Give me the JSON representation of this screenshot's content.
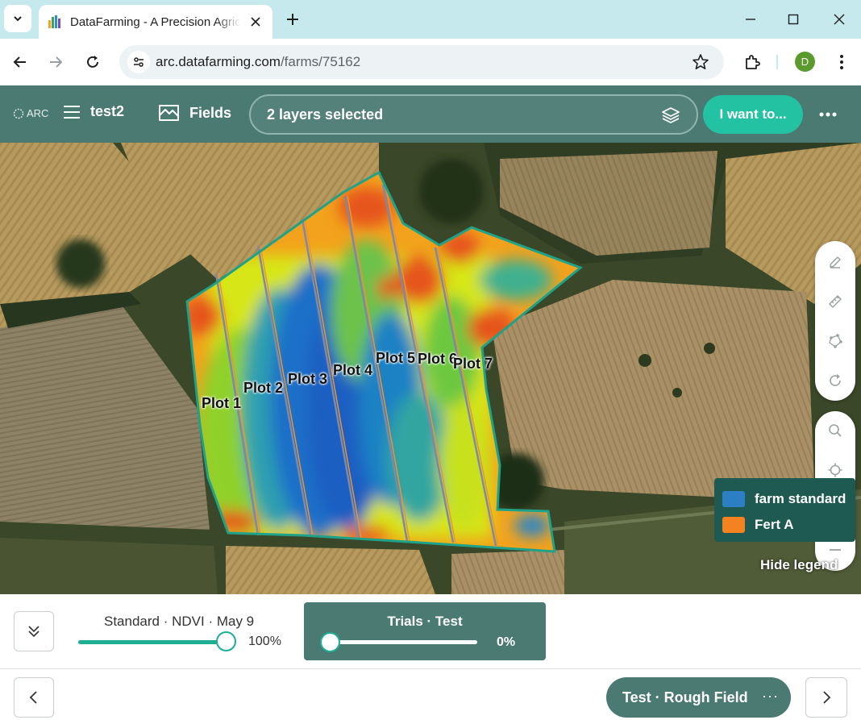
{
  "browser": {
    "tab_title": "DataFarming - A Precision Agriculture",
    "url_domain": "arc.datafarming.com",
    "url_path": "/farms/75162",
    "profile_initial": "D"
  },
  "header": {
    "logo_text": "ARC",
    "farm_name": "test2",
    "fields_label": "Fields",
    "layers_label": "2 layers selected",
    "action_label": "I want to..."
  },
  "map": {
    "plots": [
      "Plot 1",
      "Plot 2",
      "Plot 3",
      "Plot 4",
      "Plot 5",
      "Plot 6",
      "Plot 7"
    ],
    "legend": [
      {
        "label": "farm standard",
        "color": "#2c7fc3"
      },
      {
        "label": "Fert A",
        "color": "#f58220"
      }
    ],
    "hide_legend_label": "Hide legend"
  },
  "bottom": {
    "standard_title": "Standard · NDVI · May 9",
    "standard_value": 100,
    "standard_pct": "100%",
    "trials_title": "Trials · Test",
    "trials_value": 0,
    "trials_pct": "0%",
    "field_pill_label": "Test · Rough Field",
    "field_pill_more": "···"
  },
  "colors": {
    "header_bg": "#4a7a72",
    "accent": "#22c2a2",
    "legend_bg": "#1f5a52"
  }
}
